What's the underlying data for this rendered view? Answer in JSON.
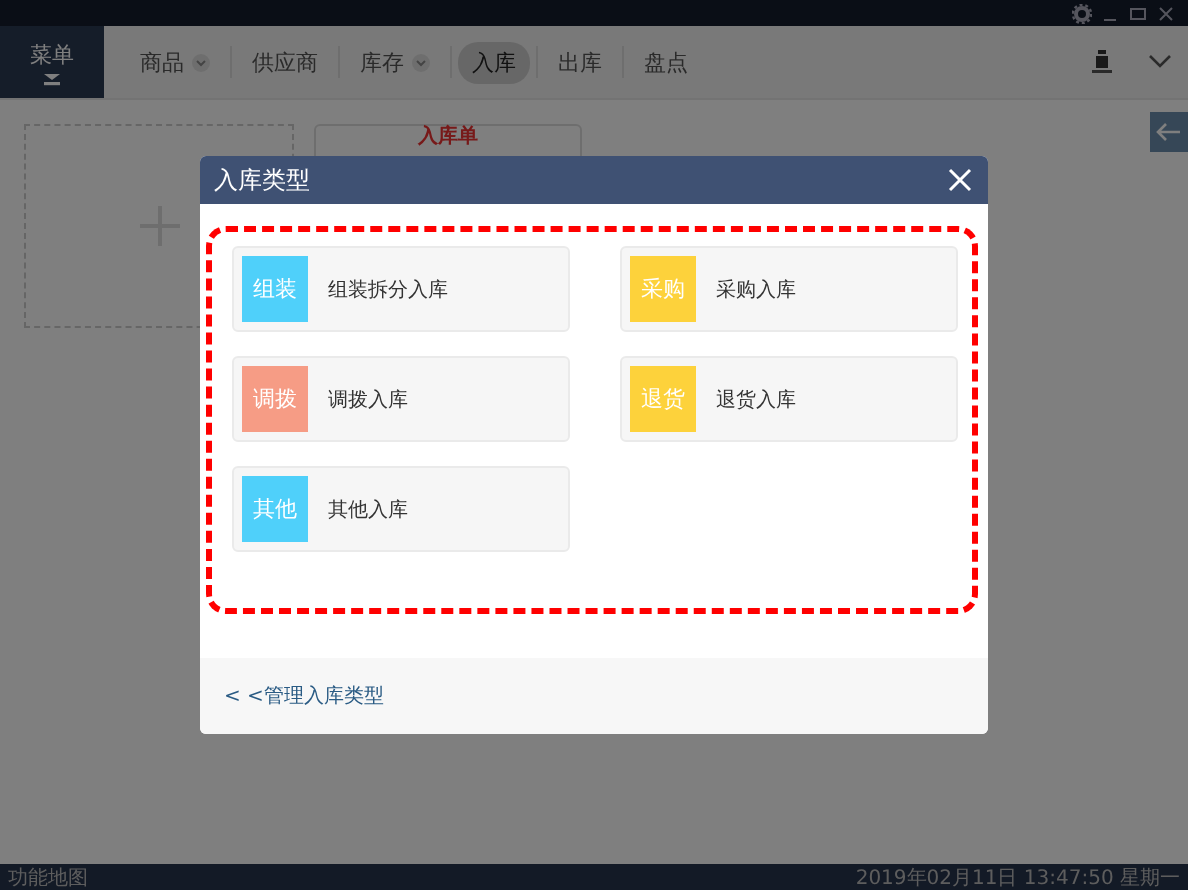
{
  "menu_button": {
    "label": "菜单"
  },
  "nav_tabs": [
    {
      "label": "商品",
      "dropdown": true,
      "selected": false
    },
    {
      "label": "供应商",
      "dropdown": false,
      "selected": false
    },
    {
      "label": "库存",
      "dropdown": true,
      "selected": false
    },
    {
      "label": "入库",
      "dropdown": false,
      "selected": true
    },
    {
      "label": "出库",
      "dropdown": false,
      "selected": false
    },
    {
      "label": "盘点",
      "dropdown": false,
      "selected": false
    }
  ],
  "order_card": {
    "title": "入库单"
  },
  "dialog": {
    "title": "入库类型",
    "types": [
      {
        "badge": "组装",
        "label": "组装拆分入库",
        "color": "#4fd0fa"
      },
      {
        "badge": "采购",
        "label": "采购入库",
        "color": "#fdd23b"
      },
      {
        "badge": "调拨",
        "label": "调拨入库",
        "color": "#f69c85"
      },
      {
        "badge": "退货",
        "label": "退货入库",
        "color": "#fdd23b"
      },
      {
        "badge": "其他",
        "label": "其他入库",
        "color": "#4fd0fa"
      }
    ],
    "footer_link": "< <管理入库类型"
  },
  "status_bar": {
    "left": "功能地图",
    "right": "2019年02月11日 13:47:50 星期一"
  }
}
